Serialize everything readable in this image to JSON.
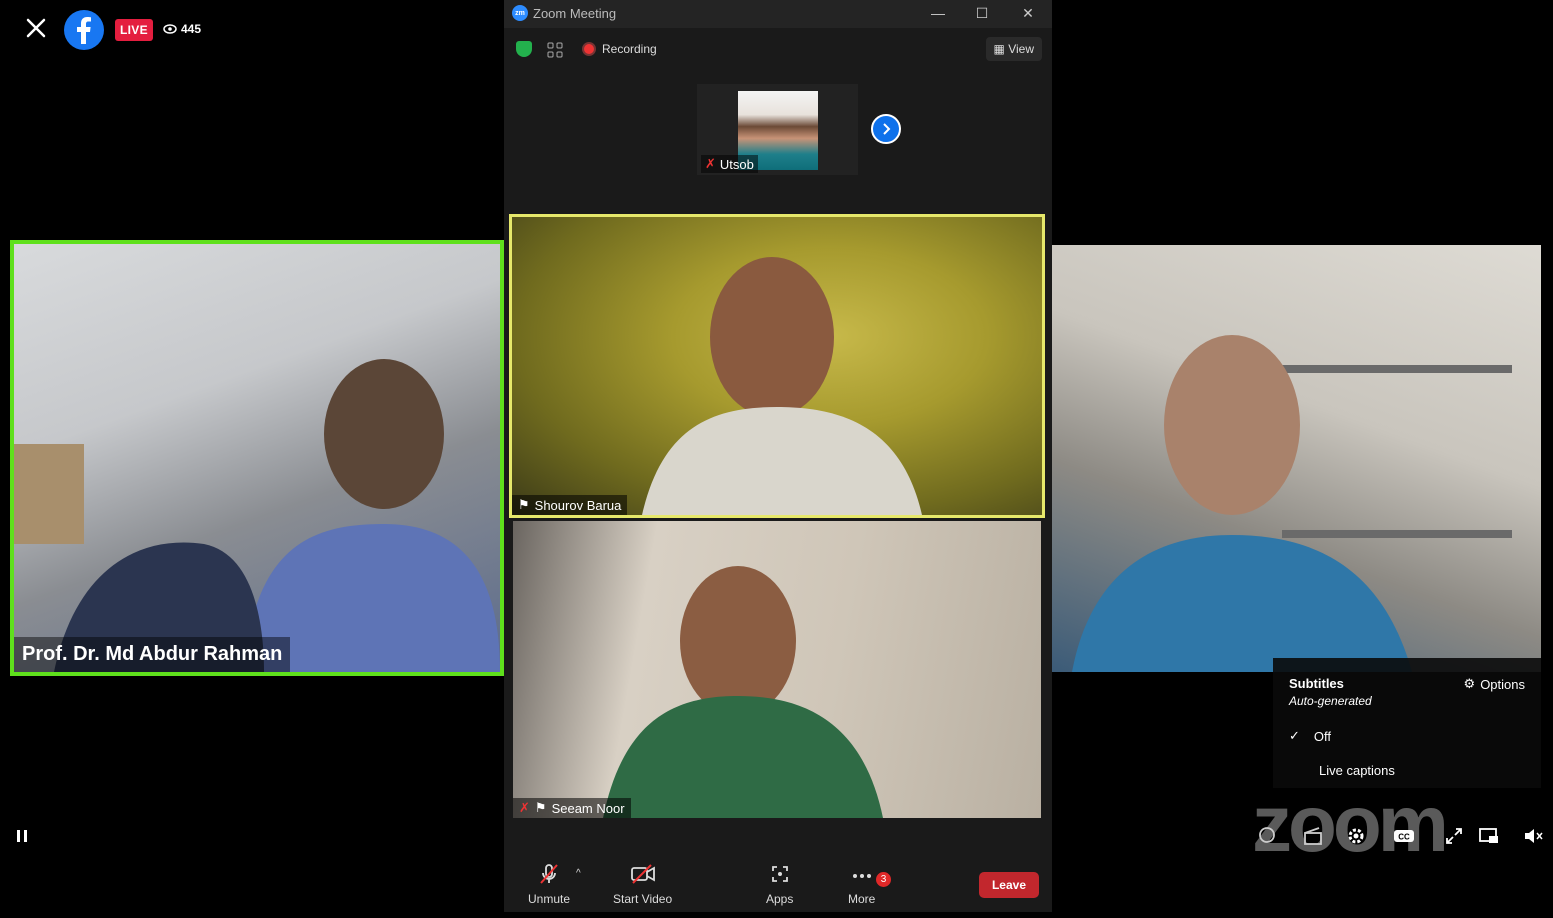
{
  "facebook": {
    "live_label": "LIVE",
    "viewer_count": "445",
    "brand_color": "#1877f2",
    "live_color": "#e41e3f"
  },
  "left_video": {
    "name": "Prof. Dr. Md Abdur Rahman",
    "border_color": "#5fe01c"
  },
  "zoom": {
    "window_title": "Zoom Meeting",
    "recording_label": "Recording",
    "view_label": "View",
    "thumbnail": {
      "name": "Utsob"
    },
    "tiles": [
      {
        "name": "Shourov Barua",
        "active_speaker": true
      },
      {
        "name": "Seeam Noor"
      }
    ],
    "controls": {
      "unmute": "Unmute",
      "start_video": "Start Video",
      "apps": "Apps",
      "more": "More",
      "more_badge": "3",
      "leave": "Leave"
    }
  },
  "subtitles_menu": {
    "title": "Subtitles",
    "subtitle": "Auto-generated",
    "options_label": "Options",
    "items": [
      "Off",
      "Live captions"
    ],
    "selected": "Off"
  },
  "watermark": "zoom"
}
